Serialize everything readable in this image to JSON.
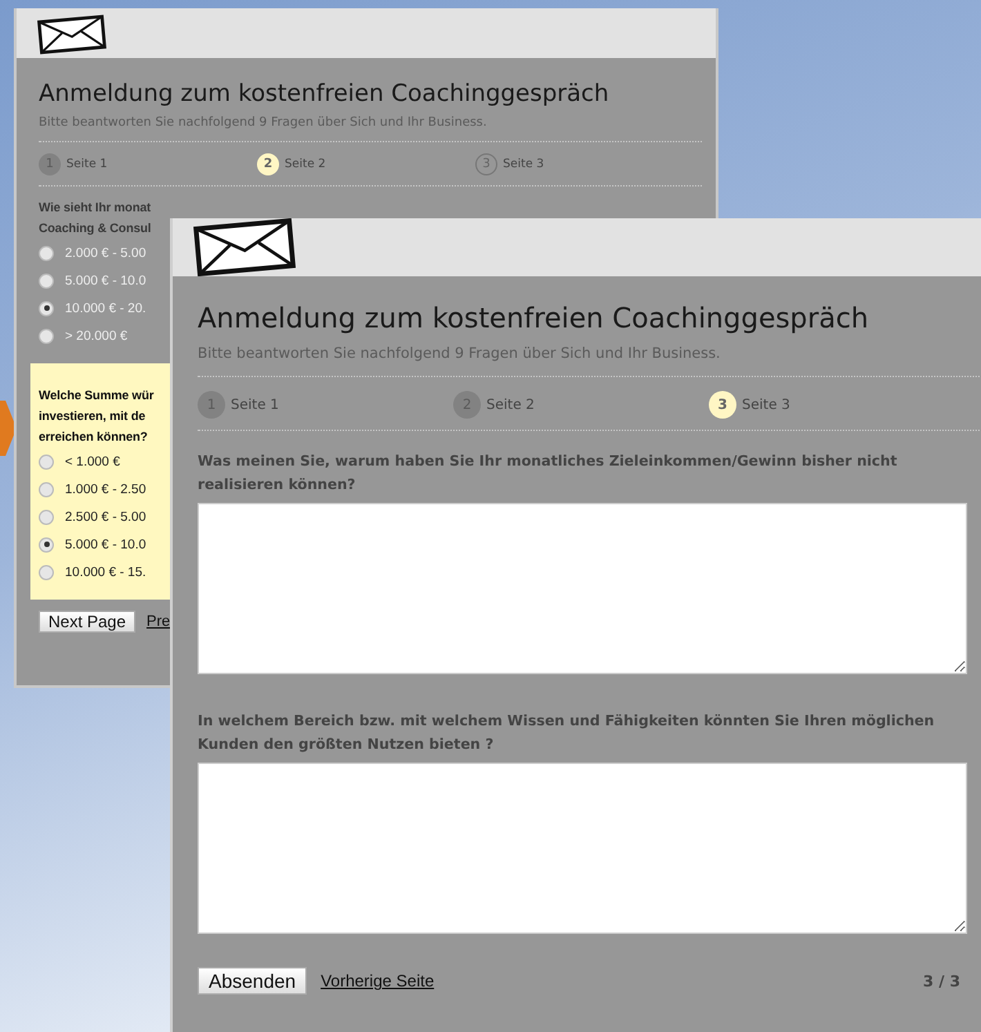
{
  "back_window": {
    "title": "Anmeldung zum kostenfreien Coachinggespräch",
    "subtitle": "Bitte beantworten Sie nachfolgend 9 Fragen über Sich und Ihr Business.",
    "steps": [
      {
        "number": "1",
        "label": "Seite 1",
        "selected": false,
        "completed": true
      },
      {
        "number": "2",
        "label": "Seite 2",
        "selected": true,
        "completed": false
      },
      {
        "number": "3",
        "label": "Seite 3",
        "selected": false,
        "completed": false
      }
    ],
    "questions": [
      {
        "kind": "radio",
        "highlighted": false,
        "lines": [
          "Wie sieht Ihr monat",
          "Coaching & Consul"
        ],
        "options": [
          {
            "label": "2.000 € - 5.00",
            "selected": false
          },
          {
            "label": "5.000 € - 10.0",
            "selected": false
          },
          {
            "label": "10.000 € - 20.",
            "selected": true
          },
          {
            "label": "> 20.000 €",
            "selected": false
          }
        ]
      },
      {
        "kind": "radio",
        "highlighted": true,
        "lines": [
          "Welche Summe wür",
          "investieren, mit de",
          "erreichen können?"
        ],
        "options": [
          {
            "label": "< 1.000 €",
            "selected": false
          },
          {
            "label": "1.000 € - 2.50",
            "selected": false
          },
          {
            "label": "2.500 € - 5.00",
            "selected": false
          },
          {
            "label": "5.000 € - 10.0",
            "selected": true
          },
          {
            "label": "10.000 € - 15.",
            "selected": false
          }
        ]
      }
    ],
    "next_button": "Next Page",
    "previous_link": "Pre"
  },
  "front_window": {
    "title": "Anmeldung zum kostenfreien Coachinggespräch",
    "subtitle": "Bitte beantworten Sie nachfolgend 9 Fragen über Sich und Ihr Business.",
    "steps": [
      {
        "number": "1",
        "label": "Seite 1",
        "selected": false,
        "completed": true
      },
      {
        "number": "2",
        "label": "Seite 2",
        "selected": false,
        "completed": true
      },
      {
        "number": "3",
        "label": "Seite 3",
        "selected": true,
        "completed": false
      }
    ],
    "questions": [
      {
        "kind": "textarea",
        "label": "Was meinen Sie, warum haben Sie Ihr monatliches Zieleinkommen/Gewinn bisher nicht realisieren können?"
      },
      {
        "kind": "textarea",
        "label": "In welchem Bereich bzw. mit welchem Wissen und Fähigkeiten könnten Sie Ihren möglichen Kunden den größten Nutzen bieten ?"
      }
    ],
    "submit_button": "Absenden",
    "previous_link": "Vorherige Seite",
    "page_indicator": "3 / 3"
  }
}
